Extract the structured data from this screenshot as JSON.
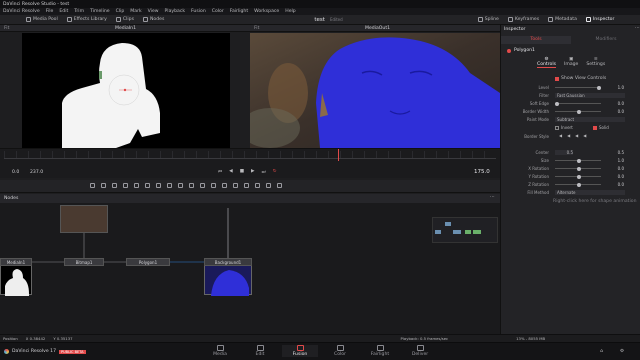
{
  "app": {
    "window_title": "DaVinci Resolve Studio - test",
    "menu": [
      "DaVinci Resolve",
      "File",
      "Edit",
      "Trim",
      "Timeline",
      "Clip",
      "Mark",
      "View",
      "Playback",
      "Fusion",
      "Color",
      "Fairlight",
      "Workspace",
      "Help"
    ]
  },
  "toolbar": {
    "media_pool": "Media Pool",
    "effects_library": "Effects Library",
    "clips": "Clips",
    "nodes": "Nodes",
    "project_name": "test",
    "project_status": "Edited",
    "spline": "Spline",
    "keyframes": "Keyframes",
    "metadata": "Metadata",
    "inspector": "Inspector"
  },
  "viewers": {
    "left_label": "MediaIn1",
    "right_label": "MediaOut1",
    "left_zoom": "Fit",
    "right_zoom": "Fit"
  },
  "timeline": {
    "start": "0.0",
    "end": "237.0",
    "current": "175.0"
  },
  "nodes_panel": {
    "title": "Nodes",
    "nodes": [
      "MediaIn1",
      "Bitmap1",
      "Polygon1",
      "Background1"
    ]
  },
  "inspector": {
    "title": "Inspector",
    "tabs": [
      "Tools",
      "Modifiers"
    ],
    "node_name": "Polygon1",
    "subtabs": [
      "Controls",
      "Image",
      "Settings"
    ],
    "show_view_controls": "Show View Controls",
    "params": [
      {
        "label": "Level",
        "value": "1.0"
      },
      {
        "label": "Filter",
        "value": "Fast Gaussian"
      },
      {
        "label": "Soft Edge",
        "value": "0.0"
      },
      {
        "label": "Border Width",
        "value": "0.0"
      },
      {
        "label": "Paint Mode",
        "value": "Subtract"
      },
      {
        "label": "",
        "value": "Invert"
      },
      {
        "label": "",
        "value": "Solid"
      },
      {
        "label": "Border Style",
        "value": ""
      },
      {
        "label": "Center",
        "value": "0.5"
      },
      {
        "label": "Size",
        "value": "1.0"
      },
      {
        "label": "X Rotation",
        "value": "0.0"
      },
      {
        "label": "Y Rotation",
        "value": "0.0"
      },
      {
        "label": "Z Rotation",
        "value": "0.0"
      },
      {
        "label": "Fill Method",
        "value": "Alternate"
      }
    ],
    "hint": "Right-click here for shape animation"
  },
  "statusbar": {
    "position": "Position",
    "x": "X 0.38442",
    "y": "Y 0.35137",
    "right": "Playback: 0.5 frames/sec",
    "zoom": "13% - 8055 MB"
  },
  "pagebar": {
    "app_name": "DaVinci Resolve 17",
    "badge": "PUBLIC BETA",
    "pages": [
      "Media",
      "Cut",
      "Edit",
      "Fusion",
      "Color",
      "Fairlight",
      "Deliver"
    ],
    "active": "Fusion"
  },
  "colors": {
    "accent": "#e24a4a",
    "mask_blue": "#2f2fd8",
    "panel": "#232326"
  }
}
